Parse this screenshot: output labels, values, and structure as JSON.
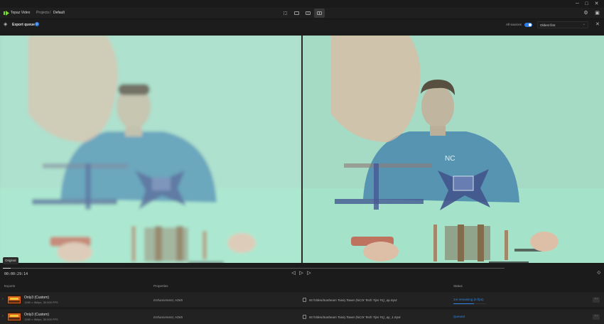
{
  "window": {
    "controls": {
      "minimize": "─",
      "maximize": "□",
      "close": "✕"
    }
  },
  "appbar": {
    "app_name": "Topaz Video",
    "breadcrumb": [
      "Projects",
      "/",
      "Default"
    ],
    "logo_color": "#7bd63a"
  },
  "queue": {
    "title": "Export queue",
    "badge": "2",
    "all_sources_label": "All sources",
    "sort_value": "Oldest first",
    "accent": "#2f7de1"
  },
  "preview": {
    "left_label": "Original"
  },
  "timeline": {
    "timecode": "00:00:29:14",
    "progress": 0.015
  },
  "exports": {
    "headers": {
      "exports": "Exports",
      "properties": "Properties",
      "status": "Status"
    },
    "rows": [
      {
        "name": "Only3 (Custom)",
        "meta": "1280 × 960px, 30.000 FPS",
        "properties": "Enhancement, H265",
        "path": "W:/Video/Sunbeam Tuniq Tower (NCIX Tech Tips #1)_ap.mp4",
        "status": "1m remaining (0 f/ps)",
        "progress": 0.62
      },
      {
        "name": "Only3 (Custom)",
        "meta": "1280 × 960px, 30.000 FPS",
        "properties": "Enhancement, H265",
        "path": "W:/Video/Sunbeam Tuniq Tower (NCIX Tech Tips #1)_ap_1.mp4",
        "status": "Queued",
        "progress": 0
      }
    ]
  }
}
